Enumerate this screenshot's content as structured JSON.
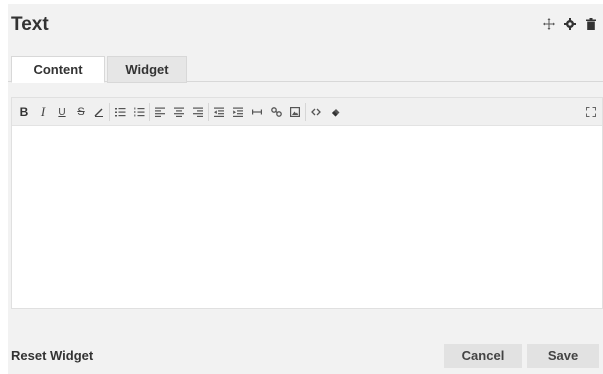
{
  "widget": {
    "title": "Text"
  },
  "header_icons": [
    "move-icon",
    "gear-icon",
    "trash-icon"
  ],
  "tabs": [
    {
      "label": "Content",
      "active": true
    },
    {
      "label": "Widget",
      "active": false
    }
  ],
  "toolbar": {
    "bold_label": "B",
    "italic_label": "I",
    "underline_label": "U",
    "strikethrough_label": "S",
    "buttons": [
      "bold-icon",
      "italic-icon",
      "underline-icon",
      "strikethrough-icon",
      "text-color-icon",
      "bulleted-list-icon",
      "numbered-list-icon",
      "align-left-icon",
      "align-center-icon",
      "align-right-icon",
      "outdent-icon",
      "indent-icon",
      "horizontal-rule-icon",
      "link-icon",
      "image-icon",
      "source-code-icon",
      "clear-formatting-icon",
      "fullscreen-icon"
    ]
  },
  "editor": {
    "content": ""
  },
  "footer": {
    "reset_label": "Reset Widget",
    "cancel_label": "Cancel",
    "save_label": "Save"
  },
  "colors": {
    "panel_bg": "#f2f2f2",
    "text": "#333333",
    "button_bg": "#e2e2e2"
  }
}
